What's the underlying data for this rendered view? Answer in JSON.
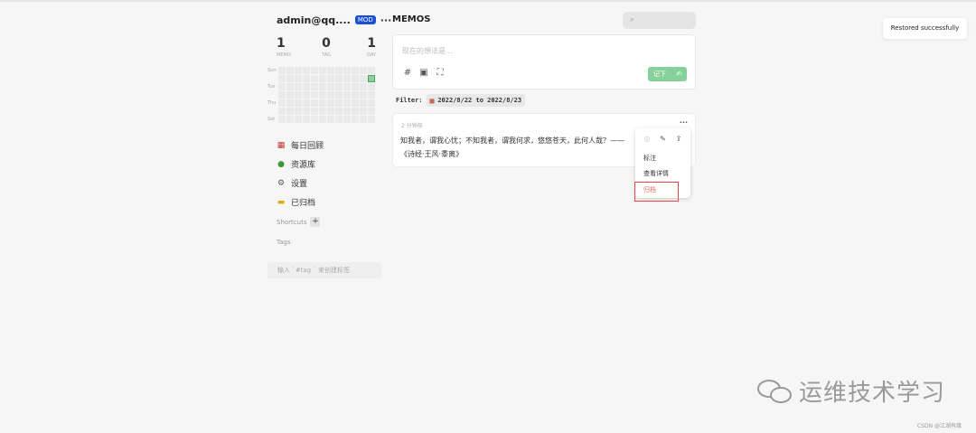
{
  "user": {
    "name": "admin@qq....",
    "badge": "MOD",
    "more": "···"
  },
  "stats": [
    {
      "value": "1",
      "label": "MEMO"
    },
    {
      "value": "0",
      "label": "TAG"
    },
    {
      "value": "1",
      "label": "DAY"
    }
  ],
  "heatmap": {
    "weekdays": [
      "Sun",
      "Tue",
      "Thu",
      "Sat"
    ],
    "active_days": 1
  },
  "nav": [
    {
      "label": "每日回顾",
      "icon": "calendar-icon"
    },
    {
      "label": "资源库",
      "icon": "resources-icon"
    },
    {
      "label": "设置",
      "icon": "gear-icon"
    },
    {
      "label": "已归档",
      "icon": "folder-icon"
    }
  ],
  "shortcuts": {
    "title": "Shortcuts",
    "add": "+"
  },
  "tags": {
    "title": "Tags",
    "hint": "输入 `#tag ` 来创建标签"
  },
  "main": {
    "title": "MEMOS"
  },
  "editor": {
    "placeholder": "现在的想法是...",
    "save": "记下"
  },
  "filter": {
    "label": "Filter:",
    "value": "2022/8/22 to 2022/8/23"
  },
  "memo": {
    "time": "2 分钟前",
    "text": "知我者，谓我心忧；不知我者，谓我何求，悠悠苍天，此何人哉？——《诗经·王风·黍离》",
    "more": "···"
  },
  "menu": {
    "items": [
      "标注",
      "查看详情",
      "归档"
    ]
  },
  "toast": {
    "text": "Restored successfully"
  },
  "watermark": {
    "text": "运维技术学习",
    "credit": "CSDN @江湖有缘"
  },
  "colors": {
    "accent": "#86d09c",
    "badge": "#1d4ed8",
    "danger": "#e06a5a"
  }
}
